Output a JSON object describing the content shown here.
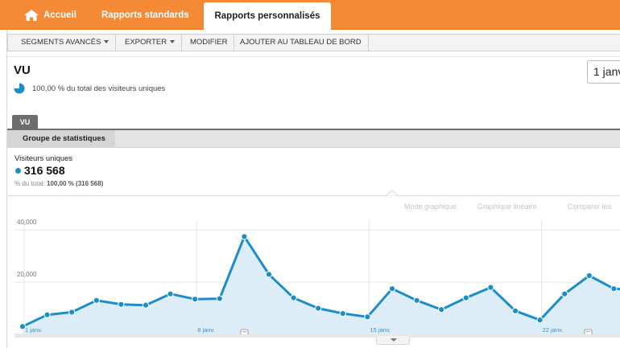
{
  "nav": {
    "home_label": "Accueil",
    "standard_reports_label": "Rapports standards",
    "custom_reports_label": "Rapports personnalisés"
  },
  "toolbar": {
    "segments_label": "SEGMENTS AVANCÉS",
    "export_label": "EXPORTER",
    "modify_label": "MODIFIER",
    "add_dashboard_label": "AJOUTER AU TABLEAU DE BORD"
  },
  "report": {
    "title": "VU",
    "subtitle": "100,00 % du total des visiteurs uniques",
    "date_range": "1 janv."
  },
  "tabs": {
    "segment_tab": "VU",
    "group_tab": "Groupe de statistiques"
  },
  "metric": {
    "label": "Visiteurs uniques",
    "value": "316 568",
    "total_prefix": "% du total: ",
    "total_value": "100,00 % (316 568)"
  },
  "chart_controls": {
    "mode_label": "Mode graphique :",
    "mode_value": "Graphique linéaire",
    "compare_label": "Comparer les"
  },
  "colors": {
    "nav_orange": "#f48a35",
    "series_blue": "#1d8dc8",
    "area_fill": "#dcedf7"
  },
  "icons": {
    "home": "home-icon",
    "pie": "pie-chart-icon",
    "annotation": "annotation-icon"
  },
  "chart_data": {
    "type": "area",
    "yticks": [
      "20,000",
      "40,000"
    ],
    "xtick_labels": [
      "1 janv.",
      "8 janv.",
      "15 janv.",
      "22 janv."
    ],
    "ylim": [
      0,
      45000
    ],
    "grid": true,
    "series": [
      {
        "values": [
          3000,
          7500,
          8500,
          13000,
          11500,
          11200,
          15500,
          13500,
          13700,
          37500,
          23000,
          14000,
          10000,
          8000,
          6700,
          17500,
          13000,
          9500,
          14000,
          18000,
          9000,
          5500,
          15500,
          22500,
          17500,
          17000
        ]
      }
    ]
  }
}
